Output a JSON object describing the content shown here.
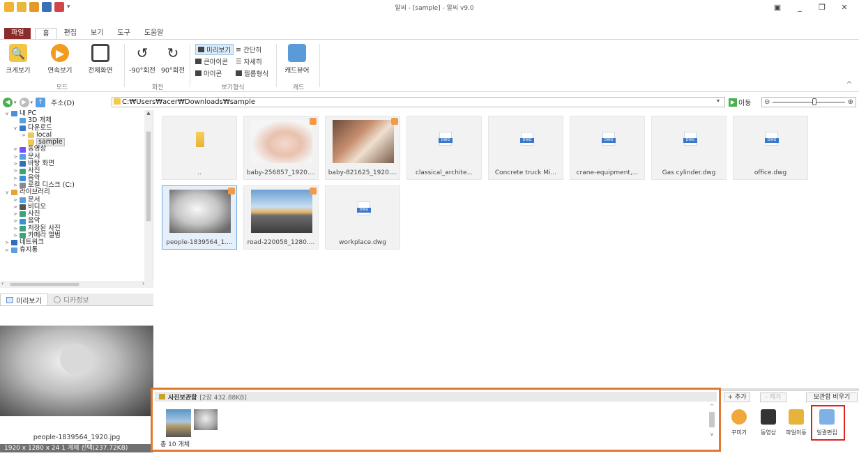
{
  "window": {
    "title": "알씨 - [sample] - 알씨 v9.0",
    "controls": [
      "▣",
      "_",
      "❐",
      "✕"
    ]
  },
  "menu": {
    "tabs": [
      "파일",
      "홈",
      "편집",
      "보기",
      "도구",
      "도움말"
    ]
  },
  "ribbon": {
    "mode": {
      "label": "모드",
      "buttons": [
        "크게보기",
        "연속보기",
        "전체화면"
      ]
    },
    "rotate": {
      "label": "회전",
      "buttons": [
        "-90°회전",
        "90°회전"
      ]
    },
    "view_format": {
      "label": "보기형식",
      "options": [
        "미리보기",
        "간단히",
        "큰아이콘",
        "자세히",
        "아이콘",
        "필름형식"
      ]
    },
    "card": {
      "label": "캐드",
      "buttons": [
        "캐드뷰어"
      ]
    }
  },
  "address": {
    "label": "주소(D)",
    "path": "C:₩Users₩acer₩Downloads₩sample",
    "go": "이동"
  },
  "tree": {
    "items": [
      {
        "label": "내 PC",
        "indent": 0,
        "toggle": "v"
      },
      {
        "label": "3D 개체",
        "indent": 1,
        "toggle": ""
      },
      {
        "label": "다운로드",
        "indent": 1,
        "toggle": "v"
      },
      {
        "label": "local",
        "indent": 2,
        "toggle": ">"
      },
      {
        "label": "sample",
        "indent": 2,
        "toggle": "",
        "selected": true
      },
      {
        "label": "동영상",
        "indent": 1,
        "toggle": ">"
      },
      {
        "label": "문서",
        "indent": 1,
        "toggle": ">"
      },
      {
        "label": "바탕 화면",
        "indent": 1,
        "toggle": ">"
      },
      {
        "label": "사진",
        "indent": 1,
        "toggle": ">"
      },
      {
        "label": "음악",
        "indent": 1,
        "toggle": ">"
      },
      {
        "label": "로컬 디스크 (C:)",
        "indent": 1,
        "toggle": ">"
      },
      {
        "label": "라이브러리",
        "indent": 0,
        "toggle": "v"
      },
      {
        "label": "문서",
        "indent": 1,
        "toggle": ">"
      },
      {
        "label": "비디오",
        "indent": 1,
        "toggle": ">"
      },
      {
        "label": "사진",
        "indent": 1,
        "toggle": ">"
      },
      {
        "label": "음악",
        "indent": 1,
        "toggle": ">"
      },
      {
        "label": "저장된 사진",
        "indent": 1,
        "toggle": ">"
      },
      {
        "label": "카메라 앨범",
        "indent": 1,
        "toggle": ">"
      },
      {
        "label": "네트워크",
        "indent": 0,
        "toggle": ">"
      },
      {
        "label": "휴지통",
        "indent": 0,
        "toggle": ">"
      }
    ]
  },
  "preview": {
    "tabs": [
      "미리보기",
      "디카정보"
    ],
    "filename": "people-1839564_1920.jpg"
  },
  "status": {
    "info": "1920 x 1280 x 24     1 개체 선택(237.72KB)"
  },
  "files": [
    {
      "name": "..",
      "kind": "folder"
    },
    {
      "name": "baby-256857_1920....",
      "kind": "photo1"
    },
    {
      "name": "baby-821625_1920....",
      "kind": "photo2"
    },
    {
      "name": "classical_archite...",
      "kind": "dwg"
    },
    {
      "name": "Concrete truck Mi...",
      "kind": "dwg"
    },
    {
      "name": "crane-equipment,...",
      "kind": "dwg"
    },
    {
      "name": "Gas cylinder.dwg",
      "kind": "dwg"
    },
    {
      "name": "office.dwg",
      "kind": "dwg"
    },
    {
      "name": "people-1839564_1....",
      "kind": "photo3",
      "selected": true
    },
    {
      "name": "road-220058_1280....",
      "kind": "photo4"
    },
    {
      "name": "workplace.dwg",
      "kind": "dwg"
    }
  ],
  "dwg_label": "DWG",
  "photobox": {
    "title": "사진보관함",
    "info": "[2장 432.88KB]",
    "footer": "총 10 개체"
  },
  "tools": {
    "add": "+ 추가",
    "remove": "- 제거",
    "empty": "보관함 비우기",
    "items": [
      "꾸미기",
      "동영상",
      "파일이동",
      "일괄편집"
    ]
  }
}
